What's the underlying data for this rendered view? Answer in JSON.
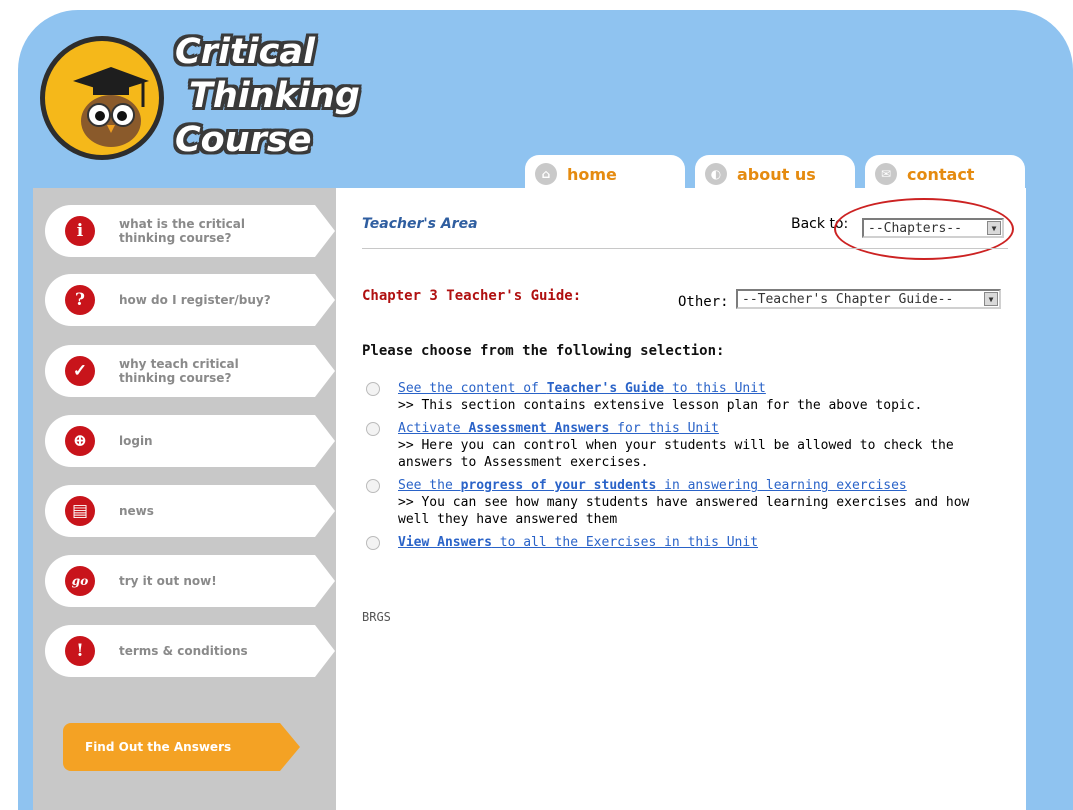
{
  "logo": {
    "line1": "Critical",
    "line2": "Thinking",
    "line3": "Course"
  },
  "tabs": [
    {
      "label": "home",
      "icon": "home-icon"
    },
    {
      "label": "about us",
      "icon": "info-icon"
    },
    {
      "label": "contact",
      "icon": "envelope-icon"
    }
  ],
  "sidebar": {
    "items": [
      {
        "label": "what is the critical thinking course?",
        "icon": "info-icon",
        "glyph": "i"
      },
      {
        "label": "how do I register/buy?",
        "icon": "question-icon",
        "glyph": "?"
      },
      {
        "label": "why teach critical thinking course?",
        "icon": "check-icon",
        "glyph": "✓"
      },
      {
        "label": "login",
        "icon": "lock-icon",
        "glyph": "⊕"
      },
      {
        "label": "news",
        "icon": "document-icon",
        "glyph": "▤"
      },
      {
        "label": "try it out now!",
        "icon": "go-icon",
        "glyph": "go"
      },
      {
        "label": "terms & conditions",
        "icon": "exclamation-icon",
        "glyph": "!"
      }
    ],
    "find_button": "Find Out the Answers"
  },
  "content": {
    "area_title": "Teacher's Area",
    "back_to_label": "Back to:",
    "chapters_select": "--Chapters--",
    "chapter_title": "Chapter 3 Teacher's Guide:",
    "other_label": "Other:",
    "guide_select": "--Teacher's Chapter Guide--",
    "prompt": "Please choose from the following selection:",
    "options": [
      {
        "pre": "See the content of ",
        "bold": "Teacher's Guide",
        "post": " to this Unit",
        "desc": ">> This section contains extensive lesson plan for the above topic."
      },
      {
        "pre": "Activate ",
        "bold": "Assessment Answers",
        "post": " for this Unit",
        "desc": ">> Here you can control when your students will be allowed to check the answers to Assessment exercises."
      },
      {
        "pre": "See the ",
        "bold": "progress of your students",
        "post": " in answering learning exercises",
        "desc": ">> You can see how many students have answered learning exercises and how well they have answered them"
      },
      {
        "pre": "",
        "bold": "View Answers",
        "post": " to all the Exercises in this Unit",
        "desc": ""
      }
    ],
    "footer": "BRGS"
  }
}
